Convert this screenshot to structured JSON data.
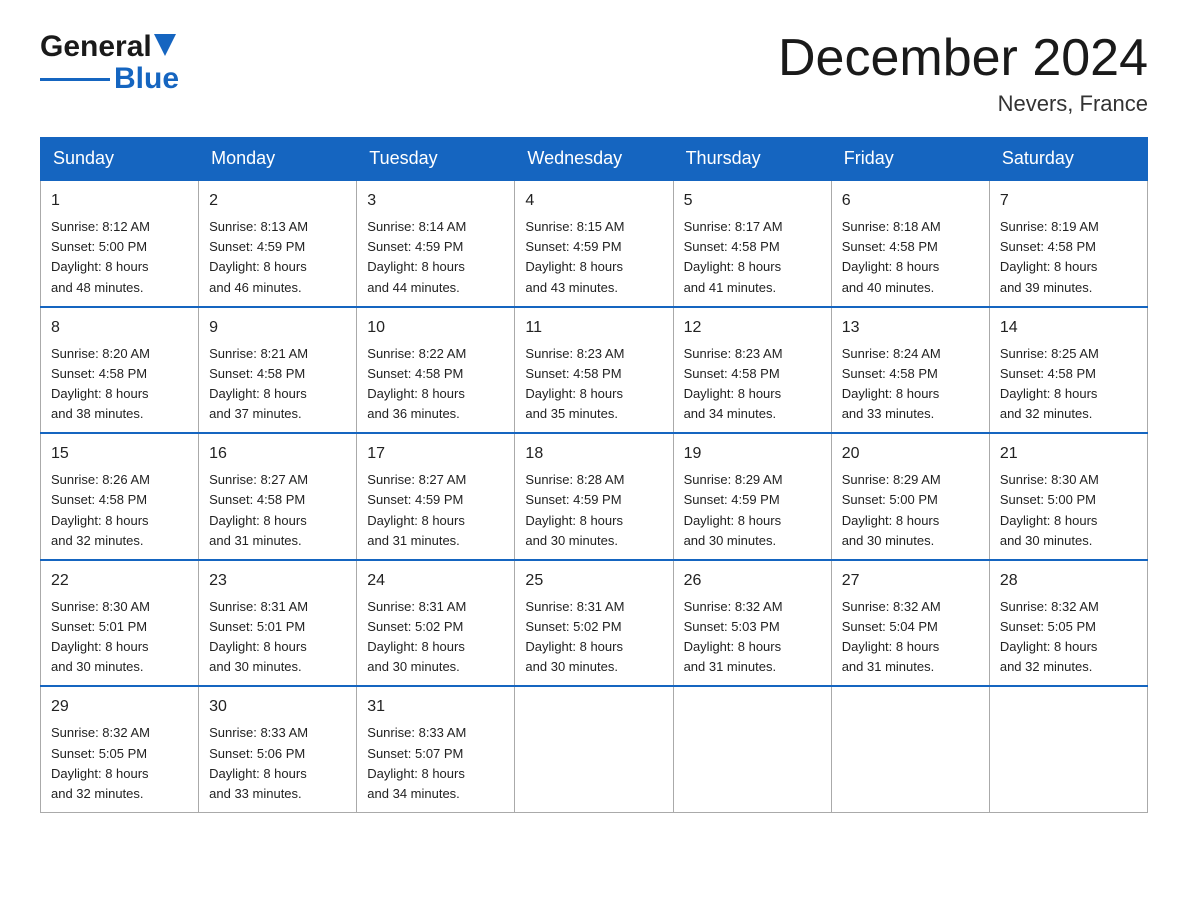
{
  "header": {
    "logo_general": "General",
    "logo_blue": "Blue",
    "month_title": "December 2024",
    "subtitle": "Nevers, France"
  },
  "days_of_week": [
    "Sunday",
    "Monday",
    "Tuesday",
    "Wednesday",
    "Thursday",
    "Friday",
    "Saturday"
  ],
  "weeks": [
    [
      {
        "num": "1",
        "sunrise": "8:12 AM",
        "sunset": "5:00 PM",
        "daylight": "8 hours and 48 minutes."
      },
      {
        "num": "2",
        "sunrise": "8:13 AM",
        "sunset": "4:59 PM",
        "daylight": "8 hours and 46 minutes."
      },
      {
        "num": "3",
        "sunrise": "8:14 AM",
        "sunset": "4:59 PM",
        "daylight": "8 hours and 44 minutes."
      },
      {
        "num": "4",
        "sunrise": "8:15 AM",
        "sunset": "4:59 PM",
        "daylight": "8 hours and 43 minutes."
      },
      {
        "num": "5",
        "sunrise": "8:17 AM",
        "sunset": "4:58 PM",
        "daylight": "8 hours and 41 minutes."
      },
      {
        "num": "6",
        "sunrise": "8:18 AM",
        "sunset": "4:58 PM",
        "daylight": "8 hours and 40 minutes."
      },
      {
        "num": "7",
        "sunrise": "8:19 AM",
        "sunset": "4:58 PM",
        "daylight": "8 hours and 39 minutes."
      }
    ],
    [
      {
        "num": "8",
        "sunrise": "8:20 AM",
        "sunset": "4:58 PM",
        "daylight": "8 hours and 38 minutes."
      },
      {
        "num": "9",
        "sunrise": "8:21 AM",
        "sunset": "4:58 PM",
        "daylight": "8 hours and 37 minutes."
      },
      {
        "num": "10",
        "sunrise": "8:22 AM",
        "sunset": "4:58 PM",
        "daylight": "8 hours and 36 minutes."
      },
      {
        "num": "11",
        "sunrise": "8:23 AM",
        "sunset": "4:58 PM",
        "daylight": "8 hours and 35 minutes."
      },
      {
        "num": "12",
        "sunrise": "8:23 AM",
        "sunset": "4:58 PM",
        "daylight": "8 hours and 34 minutes."
      },
      {
        "num": "13",
        "sunrise": "8:24 AM",
        "sunset": "4:58 PM",
        "daylight": "8 hours and 33 minutes."
      },
      {
        "num": "14",
        "sunrise": "8:25 AM",
        "sunset": "4:58 PM",
        "daylight": "8 hours and 32 minutes."
      }
    ],
    [
      {
        "num": "15",
        "sunrise": "8:26 AM",
        "sunset": "4:58 PM",
        "daylight": "8 hours and 32 minutes."
      },
      {
        "num": "16",
        "sunrise": "8:27 AM",
        "sunset": "4:58 PM",
        "daylight": "8 hours and 31 minutes."
      },
      {
        "num": "17",
        "sunrise": "8:27 AM",
        "sunset": "4:59 PM",
        "daylight": "8 hours and 31 minutes."
      },
      {
        "num": "18",
        "sunrise": "8:28 AM",
        "sunset": "4:59 PM",
        "daylight": "8 hours and 30 minutes."
      },
      {
        "num": "19",
        "sunrise": "8:29 AM",
        "sunset": "4:59 PM",
        "daylight": "8 hours and 30 minutes."
      },
      {
        "num": "20",
        "sunrise": "8:29 AM",
        "sunset": "5:00 PM",
        "daylight": "8 hours and 30 minutes."
      },
      {
        "num": "21",
        "sunrise": "8:30 AM",
        "sunset": "5:00 PM",
        "daylight": "8 hours and 30 minutes."
      }
    ],
    [
      {
        "num": "22",
        "sunrise": "8:30 AM",
        "sunset": "5:01 PM",
        "daylight": "8 hours and 30 minutes."
      },
      {
        "num": "23",
        "sunrise": "8:31 AM",
        "sunset": "5:01 PM",
        "daylight": "8 hours and 30 minutes."
      },
      {
        "num": "24",
        "sunrise": "8:31 AM",
        "sunset": "5:02 PM",
        "daylight": "8 hours and 30 minutes."
      },
      {
        "num": "25",
        "sunrise": "8:31 AM",
        "sunset": "5:02 PM",
        "daylight": "8 hours and 30 minutes."
      },
      {
        "num": "26",
        "sunrise": "8:32 AM",
        "sunset": "5:03 PM",
        "daylight": "8 hours and 31 minutes."
      },
      {
        "num": "27",
        "sunrise": "8:32 AM",
        "sunset": "5:04 PM",
        "daylight": "8 hours and 31 minutes."
      },
      {
        "num": "28",
        "sunrise": "8:32 AM",
        "sunset": "5:05 PM",
        "daylight": "8 hours and 32 minutes."
      }
    ],
    [
      {
        "num": "29",
        "sunrise": "8:32 AM",
        "sunset": "5:05 PM",
        "daylight": "8 hours and 32 minutes."
      },
      {
        "num": "30",
        "sunrise": "8:33 AM",
        "sunset": "5:06 PM",
        "daylight": "8 hours and 33 minutes."
      },
      {
        "num": "31",
        "sunrise": "8:33 AM",
        "sunset": "5:07 PM",
        "daylight": "8 hours and 34 minutes."
      },
      null,
      null,
      null,
      null
    ]
  ],
  "labels": {
    "sunrise": "Sunrise:",
    "sunset": "Sunset:",
    "daylight": "Daylight:"
  }
}
